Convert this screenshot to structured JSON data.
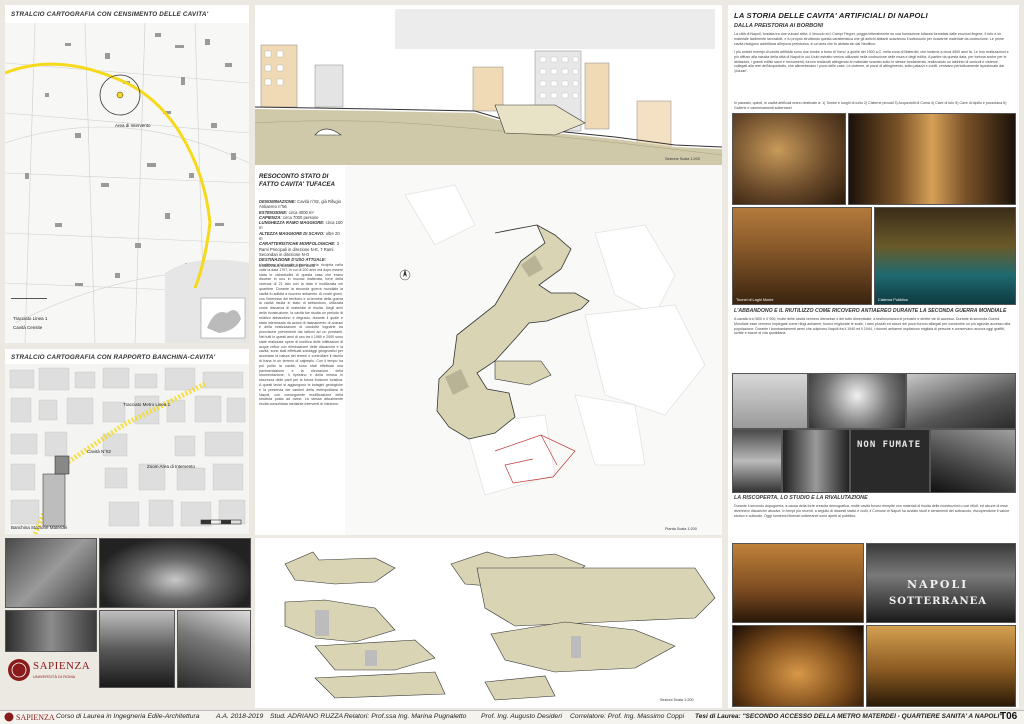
{
  "map1": {
    "title": "STRALCIO CARTOGRAFIA CON CENSIMENTO DELLE CAVITA'",
    "labels": {
      "area": "Area di Intervento",
      "metro": "Tracciato Linea 1",
      "cavities": "Cavità Censite"
    }
  },
  "map2": {
    "title": "STRALCIO CARTOGRAFIA CON RAPPORTO BANCHINA-CAVITA'",
    "labels": {
      "metro": "Tracciato Metro Linea 1",
      "cavity": "Cavità N°82",
      "area": "Zoom Area di Intervento",
      "platform": "Banchina Stazione Materdei"
    }
  },
  "section": {
    "scale": "Sezione Scala 1:200"
  },
  "report": {
    "title": "RESOCONTO STATO DI FATTO CAVITA' TUFACEA",
    "fields": [
      {
        "k": "DENOMINAZIONE:",
        "v": "Cavità n°82, già Rifugio Antiaereo n°56"
      },
      {
        "k": "ESTENSIONE:",
        "v": "circa 4000 m²"
      },
      {
        "k": "CAPIENZA:",
        "v": "circa 7000 persone"
      },
      {
        "k": "LUNGHEZZA RAMO MAGGIORE:",
        "v": "circa 100 m"
      },
      {
        "k": "ALTEZZA MAGGIORE DI SCAVO:",
        "v": "oltre 20 m"
      },
      {
        "k": "CARATTERISTICHE MORFOLOGICHE:",
        "v": "3 Rami Principali in direzione N-E, 7 Rami Secondari in direzione N-O"
      },
      {
        "k": "DESTINAZIONE D'USO ATTUALE:",
        "v": "Inutilizzata, discarica per inerti"
      }
    ],
    "body": "L'accesso alla cavità tufacea porta ricolpita nella valle la data 1797, in cui di 200 anni ma dopo essere stata le vicissitudini di questa casa che erano discese in uno in mucosi inalterata, torre della vicenda di 21 lato con la data è inutilizzata nel quartiere. Durante la seconda guerra mondiale la cavità fu adibita a ricovero antiaereo. Ai nostri giorni, con l'interesse del territorio e al termine della guerra la cavità risulta in stato di abbandono, utilizzata come discarica di materiale di risulta. Negli anni della ricostruzione, la cavità fue risulta un periodo di relativo abbandono e degrado, durante il quale è stata interessata da azioni di risanamento di anziani e della realizzazione di condotte fognarie tra provvisorie prevenienti dai lattioni ad un prestanti. Nel tutti in questi anni di uso tra il 1980 e 2000 sono state realizzate opere di bonifica delle infiltrazioni di acque reflue con eliminazione delle discariche e la cavità, sono stati effettuati sondaggi geognostici per accertare la natura dei terreni e controllare il rischio di frana in un terreno di calpestio. Con il tempo ha poi pulito la cavità, sono stati effettuati una pavimentazione e la rilevazione della strumentazione, il ripristino e della messa in sicurezza delle parti per la futura fruizione turistica. A questi lavori si aggiungono le indagini geologiche e la presenza dei cantieri della metropolitana di Napoli, con conseguente modificazione della struttura posta ad ovest. La stessa attualmente risulta consolidata mediante interventi di iniezione."
  },
  "plan": {
    "scale": "Pianta Scala 1:200"
  },
  "sections2": {
    "scale": "Sezioni Scala 1:200"
  },
  "right": {
    "title": "LA STORIA DELLE CAVITA' ARTIFICIALI DI NAPOLI",
    "subtitle": "DALLA PREISTORIA AI BORBONI",
    "p1": "La città di Napoli, fondata tra due vulcani attivi, il Vesuvio ed i Campi Flegrei, poggia letteralmente su una formazione tufacea formatasi dalle eruzioni flegree. Il tufo è un materiale facilmente lavorabile, e fu proprio sfruttando questa caratteristica che gli antichi abitanti scavarono il sottosuolo per ricavarne materiale da costruzione. Le prime cavità risalgono addirittura all'epoca preistorica, in un'area che fu abitata sin dal Neolitico.",
    "p2": "I più antichi esempi di cavità artificiali sono due tombe a forno di 'forno' a quelle del 1900 a.C. nella zona di Materdei, che insieme a circa 4500 anni fa. Le loro realizzazioni e più diffuse alla nascita della città di Napoli in cui il tufo estratto veniva utilizzato nella costruzione delle mura e degli edifici. A partire da questa data, per fortuna anche per le abitazioni, i grandi edifici sacri e monumenti, furono realizzati attingendo al materiale scavato sotto le stesse fondamenta, realizzando un labirinto di cunicoli e cisterne, collegati alla rete dell'acquedotto, che alimentavano i pozzi delle case. Le cisterne, ai pozzi di attingimento, sotto palazzi e cortili, venivano periodicamente ispezionate dai 'pozzari'.",
    "p3": "In passato, quindi, le cavità artificiali erano destinate a: 1) Tombe e luoghi di culto 2) Cisterne pluviali 3) Acquedotti di Cuma 4) Cave di tufo 5) Cave di lapillo e pozzolana 6) Gallerie e camminamenti sotterranei",
    "ww2_title": "L'ABBANDONO E IL RIUTILIZZO COME RICOVERO ANTIAEREO DURANTE LA SECONDA GUERRA MONDIALE",
    "ww2_text": "A cavallo tra l'800 e il '900, molte delle cavità vennero dismesse o del tutto dimenticate, a testimonianza le precarie e strette vie di accesso. Durante la seconda Guerra Mondiale esse vennero impiegate come rifugi antiaerei; furono migliorate le scale, i rami pluviali ed alcuni dei pozzi furono allargati per consentire un più agevole accesso alla popolazione. Durante i bombardamenti aerei che colpirono Napoli fra il 1940 ed il 1944, i ricoveri antiaerei ospitarono migliaia di persone e conservano ancora oggi graffiti, scritte e tracce di vita quotidiana.",
    "rediscovery_title": "LA RISCOPERTA, LO STUDIO E LA RIVALUTAZIONE",
    "rediscovery_text": "Durante il secondo dopoguerra, a causa della forte crescita demografica, molte cavità furono riempite con materiali di risulta delle ricostruzioni o con rifiuti, ed alcune di esse divennero discariche abusive. In tempi più recenti, a seguito di dissesti statici e crolli, il Comune di Napoli ha avviato studi e censimenti del sottosuolo, riscoprendone il valore storico e culturale. Oggi numerosi itinerari sotterranei sono aperti al pubblico.",
    "captions": [
      "Tunnel di Laghi Monte",
      "Cisterna Pubblica"
    ],
    "sign_lines": [
      "NON FUMATE",
      "NAPOLI",
      "SOTTERRANEA"
    ]
  },
  "footer": {
    "uni": "SAPIENZA",
    "uni_sub": "UNIVERSITÀ DI ROMA",
    "course": "Corso di Laurea in Ingegneria Edile-Architettura",
    "year": "A.A. 2018-2019",
    "student": "Stud. ADRIANO RUZZA",
    "advisors": "Relatori: Prof.ssa Ing. Marina Pugnaletto",
    "advisor2": "Prof. Ing. Augusto Desideri",
    "corr": "Correlatore: Prof. Ing. Massimo Coppi",
    "thesis": "Tesi di Laurea: \"SECONDO ACCESSO DELLA METRO MATERDEI - QUARTIERE SANITA' A NAPOLI\"",
    "table": "T06"
  },
  "colors": {
    "background": "#ece9e2",
    "tuff": "#d8d4b4",
    "accent_yellow": "#f5d91a",
    "dark": "#1f1f1f"
  }
}
